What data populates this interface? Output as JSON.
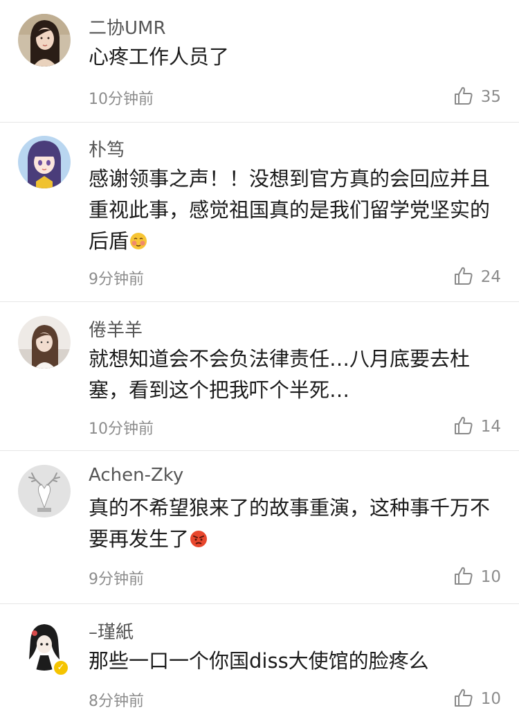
{
  "comments": [
    {
      "username": "二协UMR",
      "text": "心疼工作人员了",
      "time": "10分钟前",
      "likes": "35",
      "avatar": "woman-photo-avatar"
    },
    {
      "username": "朴笃",
      "text": "感谢领事之声！！没想到官方真的会回应并且重视此事，感觉祖国真的是我们留学党坚实的后盾",
      "emoji": "blush-emoji",
      "time": "9分钟前",
      "likes": "24",
      "avatar": "anime-girl-avatar"
    },
    {
      "username": "倦羊羊",
      "text": "就想知道会不会负法律责任…八月底要去杜塞，看到这个把我吓个半死…",
      "time": "10分钟前",
      "likes": "14",
      "avatar": "girl-photo-avatar"
    },
    {
      "username": "Achen-Zky",
      "text": "真的不希望狼来了的故事重演，这种事千万不要再发生了",
      "emoji": "angry-emoji",
      "time": "9分钟前",
      "likes": "10",
      "avatar": "deer-head-avatar"
    },
    {
      "username": "–瑾紙",
      "text": "那些一口一个你国diss大使馆的脸疼么",
      "time": "8分钟前",
      "likes": "10",
      "avatar": "cartoon-girl-avatar",
      "verified_badge": "v-badge"
    }
  ],
  "icons": {
    "like": "thumbs-up-icon"
  },
  "colors": {
    "username": "#555555",
    "meta": "#8c8c8c",
    "divider": "#e6e6e6",
    "badge": "#f5c400"
  }
}
